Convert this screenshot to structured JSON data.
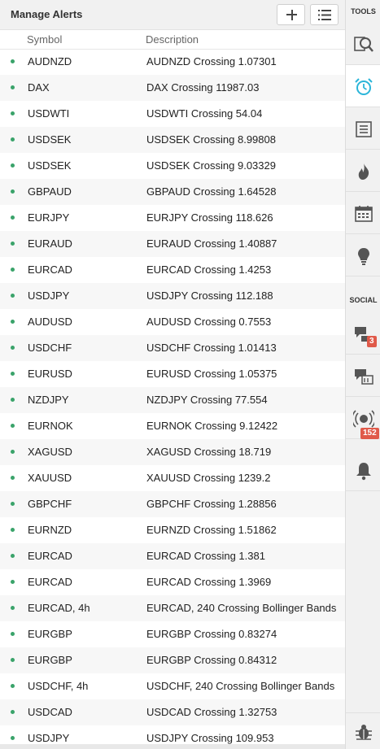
{
  "header": {
    "title": "Manage Alerts"
  },
  "columns": {
    "symbol": "Symbol",
    "description": "Description"
  },
  "alerts": [
    {
      "symbol": "AUDNZD",
      "description": "AUDNZD Crossing 1.07301"
    },
    {
      "symbol": "DAX",
      "description": "DAX Crossing 11987.03"
    },
    {
      "symbol": "USDWTI",
      "description": "USDWTI Crossing 54.04"
    },
    {
      "symbol": "USDSEK",
      "description": "USDSEK Crossing 8.99808"
    },
    {
      "symbol": "USDSEK",
      "description": "USDSEK Crossing 9.03329"
    },
    {
      "symbol": "GBPAUD",
      "description": "GBPAUD Crossing 1.64528"
    },
    {
      "symbol": "EURJPY",
      "description": "EURJPY Crossing 118.626"
    },
    {
      "symbol": "EURAUD",
      "description": "EURAUD Crossing 1.40887"
    },
    {
      "symbol": "EURCAD",
      "description": "EURCAD Crossing 1.4253"
    },
    {
      "symbol": "USDJPY",
      "description": "USDJPY Crossing 112.188"
    },
    {
      "symbol": "AUDUSD",
      "description": "AUDUSD Crossing 0.7553"
    },
    {
      "symbol": "USDCHF",
      "description": "USDCHF Crossing 1.01413"
    },
    {
      "symbol": "EURUSD",
      "description": "EURUSD Crossing 1.05375"
    },
    {
      "symbol": "NZDJPY",
      "description": "NZDJPY Crossing 77.554"
    },
    {
      "symbol": "EURNOK",
      "description": "EURNOK Crossing 9.12422"
    },
    {
      "symbol": "XAGUSD",
      "description": "XAGUSD Crossing 18.719"
    },
    {
      "symbol": "XAUUSD",
      "description": "XAUUSD Crossing 1239.2"
    },
    {
      "symbol": "GBPCHF",
      "description": "GBPCHF Crossing 1.28856"
    },
    {
      "symbol": "EURNZD",
      "description": "EURNZD Crossing 1.51862"
    },
    {
      "symbol": "EURCAD",
      "description": "EURCAD Crossing 1.381"
    },
    {
      "symbol": "EURCAD",
      "description": "EURCAD Crossing 1.3969"
    },
    {
      "symbol": "EURCAD, 4h",
      "description": "EURCAD, 240 Crossing Bollinger Bands"
    },
    {
      "symbol": "EURGBP",
      "description": "EURGBP Crossing 0.83274"
    },
    {
      "symbol": "EURGBP",
      "description": "EURGBP Crossing 0.84312"
    },
    {
      "symbol": "USDCHF, 4h",
      "description": "USDCHF, 240 Crossing Bollinger Bands"
    },
    {
      "symbol": "USDCAD",
      "description": "USDCAD Crossing 1.32753"
    },
    {
      "symbol": "USDJPY",
      "description": "USDJPY Crossing 109.953"
    }
  ],
  "sidebar": {
    "tools_label": "TOOLS",
    "social_label": "SOCIAL",
    "chat_badge": "3",
    "stream_badge": "152",
    "accent_color": "#2bb5d9",
    "status_dot_color": "#3aa36a",
    "badge_color": "#e05a4a"
  }
}
